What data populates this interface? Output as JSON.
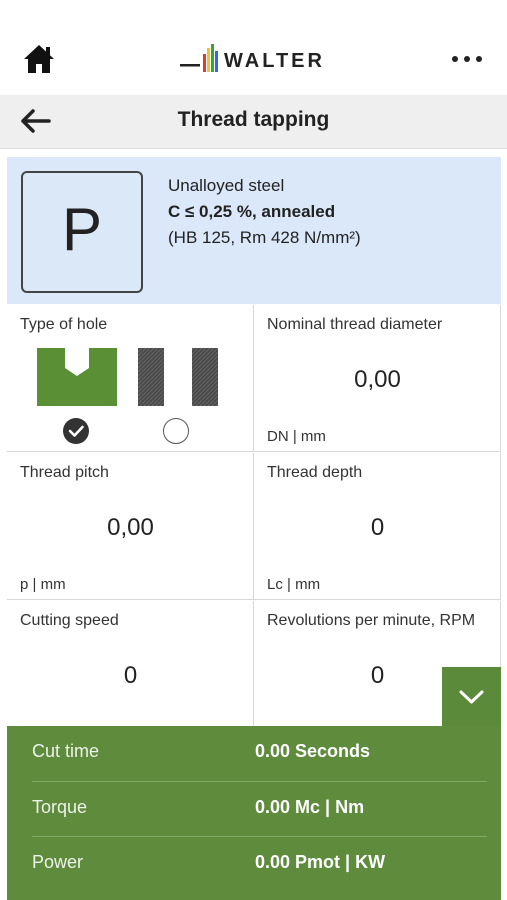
{
  "header": {
    "logo_text": "WALTER",
    "home_icon": "home-icon",
    "more_icon": "more-icon"
  },
  "titlebar": {
    "title": "Thread tapping",
    "back_icon": "back-arrow-icon"
  },
  "material": {
    "group": "P",
    "name": "Unalloyed steel",
    "spec": "C ≤ 0,25 %, annealed",
    "hardness": "(HB 125, Rm 428 N/mm²)"
  },
  "fields": {
    "type_of_hole": {
      "label": "Type of hole",
      "selected": "blind"
    },
    "nominal_diameter": {
      "label": "Nominal thread diameter",
      "value": "0,00",
      "unit": "DN | mm"
    },
    "thread_pitch": {
      "label": "Thread pitch",
      "value": "0,00",
      "unit": "p | mm"
    },
    "thread_depth": {
      "label": "Thread depth",
      "value": "0",
      "unit": "Lc | mm"
    },
    "cutting_speed": {
      "label": "Cutting speed",
      "value": "0"
    },
    "rpm": {
      "label": "Revolutions per minute, RPM",
      "value": "0"
    }
  },
  "results": {
    "cut_time": {
      "label": "Cut time",
      "value": "0.00 Seconds"
    },
    "torque": {
      "label": "Torque",
      "value": "0.00  Mc | Nm"
    },
    "power": {
      "label": "Power",
      "value": "0.00  Pmot | KW"
    }
  },
  "colors": {
    "accent_green": "#5e8b3c",
    "material_bg": "#dae8f9"
  }
}
